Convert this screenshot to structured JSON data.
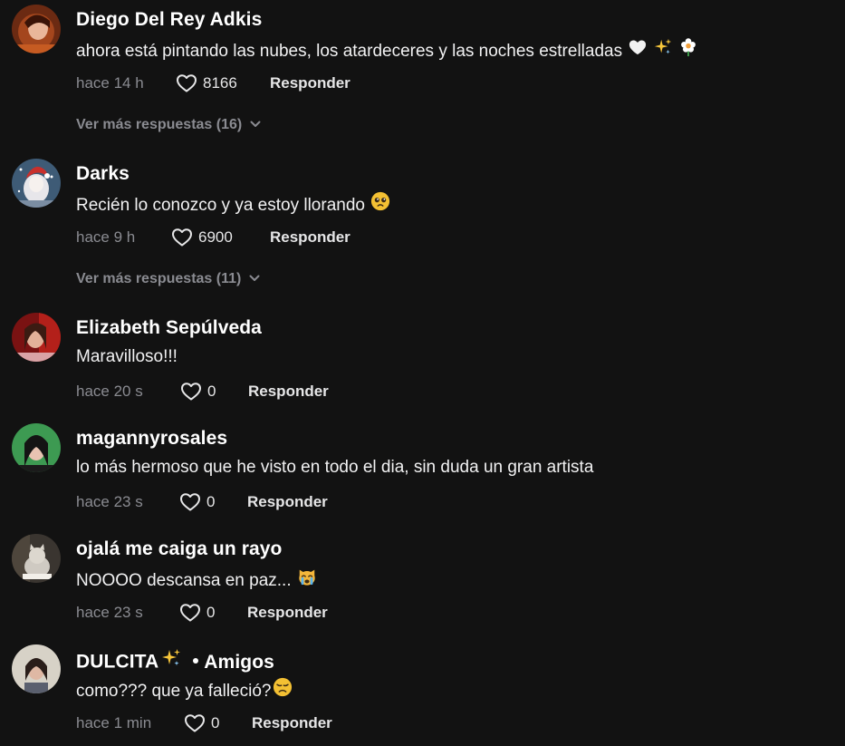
{
  "colors": {
    "background": "#121212",
    "text_primary": "#ffffff",
    "text_secondary": "#8a8b91"
  },
  "comments": [
    {
      "username": "Diego Del Rey Adkis",
      "text": "ahora está pintando las nubes, los atardeceres y las noches estrelladas",
      "emojis": [
        "white-heart",
        "sparkles",
        "blossom"
      ],
      "time": "hace 14 h",
      "likes": "8166",
      "reply": "Responder",
      "more_replies": "Ver más respuestas (16)"
    },
    {
      "username": "Darks",
      "text": "Recién lo conozco y ya estoy llorando",
      "emojis": [
        "pleading-face"
      ],
      "time": "hace 9 h",
      "likes": "6900",
      "reply": "Responder",
      "more_replies": "Ver más respuestas (11)"
    },
    {
      "username": "Elizabeth Sepúlveda",
      "text": "Maravilloso!!!",
      "time": "hace 20 s",
      "likes": "0",
      "reply": "Responder"
    },
    {
      "username": "magannyrosales",
      "text": "lo más hermoso que he visto en todo el dia, sin duda un gran artista",
      "time": "hace 23 s",
      "likes": "0",
      "reply": "Responder"
    },
    {
      "username": "ojalá me caiga un rayo",
      "text": "NOOOO descansa en paz...",
      "emojis": [
        "crying-cat"
      ],
      "time": "hace 23 s",
      "likes": "0",
      "reply": "Responder"
    },
    {
      "username": "DULCITA",
      "username_emoji": "sparkles",
      "friends_label": "Amigos",
      "text": "como??? que ya falleció?",
      "emojis": [
        "disappointed-face"
      ],
      "time": "hace 1 min",
      "likes": "0",
      "reply": "Responder"
    }
  ]
}
